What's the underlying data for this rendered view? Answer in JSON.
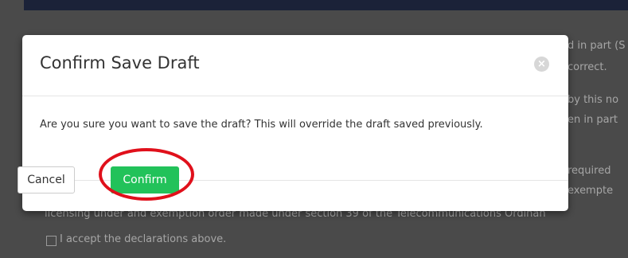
{
  "background": {
    "text_lines": [
      "d in part (S",
      "correct.",
      "by this no",
      "en in part",
      "required",
      "exempte",
      "licensing under and exemption order made under section 39 of the Telecommunications Ordinan"
    ],
    "checkbox_label": "I accept the declarations above."
  },
  "modal": {
    "title": "Confirm Save Draft",
    "close_glyph": "×",
    "message": "Are you sure you want to save the draft? This will override the draft saved previously.",
    "cancel_label": "Cancel",
    "confirm_label": "Confirm"
  },
  "colors": {
    "overlay": "#4a4a4a",
    "confirm": "#22c25a",
    "highlight": "#e0101b"
  }
}
